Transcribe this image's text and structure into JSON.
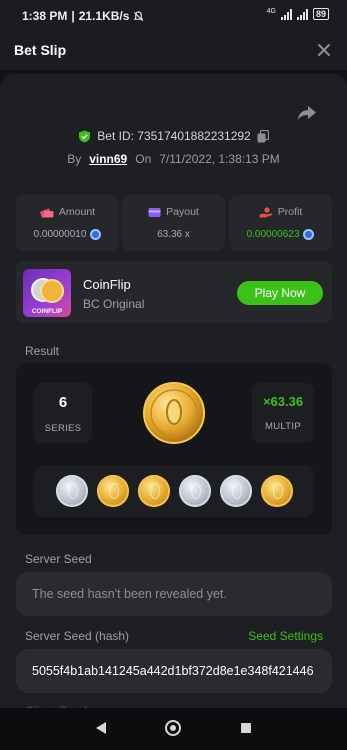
{
  "status_bar": {
    "time": "1:38 PM",
    "speed": "21.1KB/s",
    "network": "4G",
    "battery": "89"
  },
  "header": {
    "title": "Bet Slip"
  },
  "bet": {
    "id_label": "Bet ID: 73517401882231292",
    "by_label": "By",
    "username": "vinn69",
    "on_label": "On",
    "datetime": "7/11/2022, 1:38:13 PM"
  },
  "stats": {
    "amount_label": "Amount",
    "amount_value": "0.00000010",
    "payout_label": "Payout",
    "payout_value": "63.36 x",
    "profit_label": "Profit",
    "profit_value": "0.00000623"
  },
  "game": {
    "name": "CoinFlip",
    "subtitle": "BC Original",
    "thumb_text": "COINFLIP",
    "play_button": "Play Now"
  },
  "result": {
    "section_label": "Result",
    "series_value": "6",
    "series_label": "SERIES",
    "multiplier_value": "×63.36",
    "multiplier_label": "MULTIP",
    "coins": [
      "silver",
      "gold",
      "gold",
      "silver",
      "silver",
      "gold"
    ]
  },
  "server_seed": {
    "label": "Server Seed",
    "placeholder": "The seed hasn't been revealed yet."
  },
  "server_seed_hash": {
    "label": "Server Seed (hash)",
    "settings_link": "Seed Settings",
    "value": "5055f4b1ab141245a442d1bf372d8e1e348f421446"
  },
  "client_seed": {
    "label": "Client Seed"
  },
  "colors": {
    "accent_green": "#3bc117",
    "background": "#121316",
    "card": "#26272b"
  }
}
